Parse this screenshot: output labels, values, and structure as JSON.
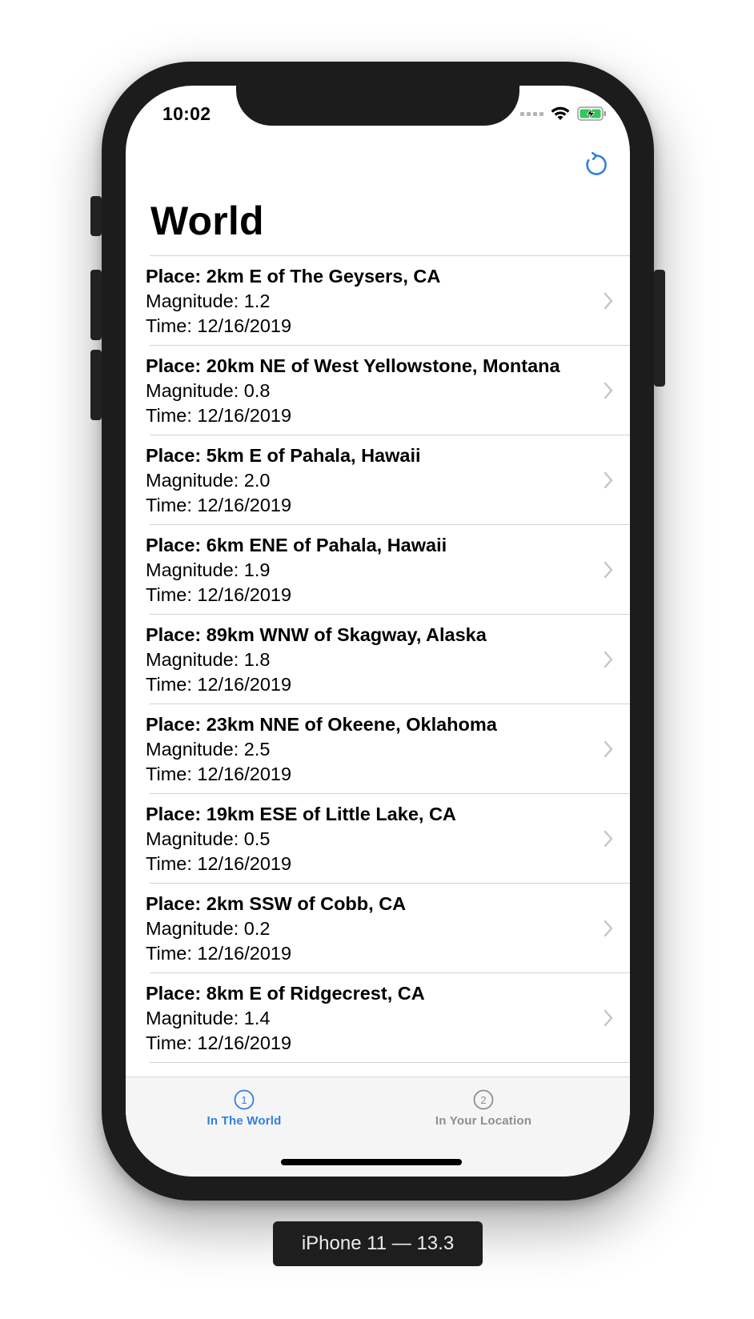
{
  "status_bar": {
    "time": "10:02",
    "icons": [
      "cellular-signal-icon",
      "wifi-icon",
      "battery-charging-icon"
    ]
  },
  "nav": {
    "title": "World",
    "refresh_icon": "refresh-icon"
  },
  "earthquakes": [
    {
      "place": "Place: 2km E of The Geysers, CA",
      "magnitude": "Magnitude: 1.2",
      "time": "Time: 12/16/2019"
    },
    {
      "place": "Place: 20km NE of West Yellowstone, Montana",
      "magnitude": "Magnitude: 0.8",
      "time": "Time: 12/16/2019"
    },
    {
      "place": "Place: 5km E of Pahala, Hawaii",
      "magnitude": "Magnitude: 2.0",
      "time": "Time: 12/16/2019"
    },
    {
      "place": "Place: 6km ENE of Pahala, Hawaii",
      "magnitude": "Magnitude: 1.9",
      "time": "Time: 12/16/2019"
    },
    {
      "place": "Place: 89km WNW of Skagway, Alaska",
      "magnitude": "Magnitude: 1.8",
      "time": "Time: 12/16/2019"
    },
    {
      "place": "Place: 23km NNE of Okeene, Oklahoma",
      "magnitude": "Magnitude: 2.5",
      "time": "Time: 12/16/2019"
    },
    {
      "place": "Place: 19km ESE of Little Lake, CA",
      "magnitude": "Magnitude: 0.5",
      "time": "Time: 12/16/2019"
    },
    {
      "place": "Place: 2km SSW of Cobb, CA",
      "magnitude": "Magnitude: 0.2",
      "time": "Time: 12/16/2019"
    },
    {
      "place": "Place: 8km E of Ridgecrest, CA",
      "magnitude": "Magnitude: 1.4",
      "time": "Time: 12/16/2019"
    }
  ],
  "tabbar": {
    "tabs": [
      {
        "number": "1",
        "label": "In The World",
        "selected": true
      },
      {
        "number": "2",
        "label": "In Your Location",
        "selected": false
      }
    ]
  },
  "device_label": "iPhone 11 — 13.3",
  "colors": {
    "accent": "#2f7fe0",
    "tab_inactive": "#8e8e93",
    "separator": "#d3d3d6",
    "chevron": "#c4c4c7",
    "battery": "#34c759"
  }
}
